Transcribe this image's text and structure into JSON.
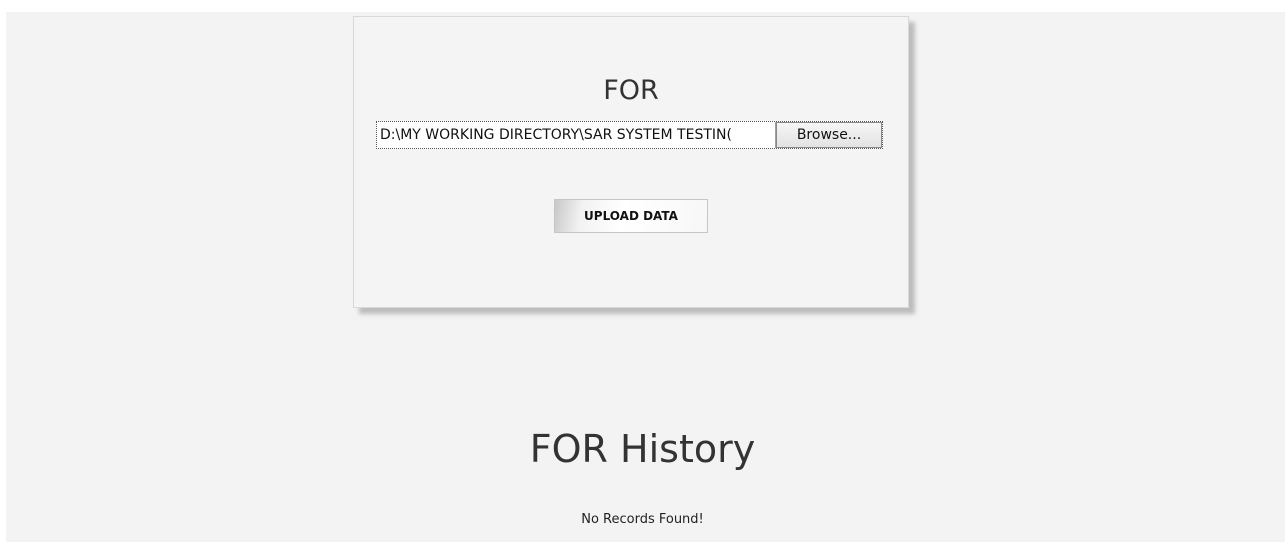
{
  "upload_panel": {
    "title": "FOR",
    "file_input": {
      "value": "D:\\MY WORKING DIRECTORY\\SAR SYSTEM TESTIN(",
      "browse_label": "Browse..."
    },
    "upload_label": "UPLOAD DATA"
  },
  "history": {
    "title": "FOR History",
    "empty_message": "No Records Found!"
  }
}
